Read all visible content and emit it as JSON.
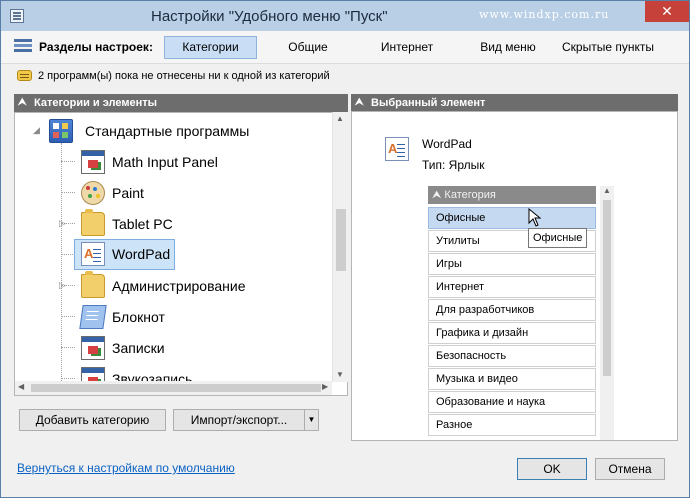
{
  "window": {
    "title": "Настройки \"Удобного меню \"Пуск\"",
    "watermark": "www.windxp.com.ru",
    "close_label": "✕"
  },
  "toolbar": {
    "label": "Разделы настроек:",
    "tabs": [
      {
        "label": "Категории",
        "active": true
      },
      {
        "label": "Общие",
        "active": false
      },
      {
        "label": "Интернет",
        "active": false
      },
      {
        "label": "Вид меню",
        "active": false
      },
      {
        "label": "Скрытые пункты",
        "active": false
      }
    ]
  },
  "info": {
    "text": "2 программ(ы) пока не отнесены ни к одной из категорий"
  },
  "left_panel": {
    "header": "Категории и элементы",
    "tree": [
      {
        "label": "Стандартные программы",
        "icon": "grid-icon",
        "expanded": true,
        "selected": false
      },
      {
        "label": "Math Input Panel",
        "icon": "window-icon",
        "expanded": false,
        "selected": false
      },
      {
        "label": "Paint",
        "icon": "palette-icon",
        "expanded": false,
        "selected": false
      },
      {
        "label": "Tablet PC",
        "icon": "folder-icon",
        "expanded": false,
        "selected": false
      },
      {
        "label": "WordPad",
        "icon": "wordpad-icon",
        "expanded": false,
        "selected": true
      },
      {
        "label": "Администрирование",
        "icon": "folder-icon",
        "expanded": false,
        "selected": false
      },
      {
        "label": "Блокнот",
        "icon": "notepad-icon",
        "expanded": false,
        "selected": false
      },
      {
        "label": "Записки",
        "icon": "window-icon",
        "expanded": false,
        "selected": false
      },
      {
        "label": "Звукозапись",
        "icon": "window-icon",
        "expanded": false,
        "selected": false
      }
    ],
    "add_category_label": "Добавить категорию",
    "import_export_label": "Импорт/экспорт..."
  },
  "right_panel": {
    "header": "Выбранный элемент",
    "item_name": "WordPad",
    "item_type": "Тип: Ярлык",
    "category_header": "Категория",
    "categories": [
      {
        "label": "Офисные",
        "active": true
      },
      {
        "label": "Утилиты",
        "active": false
      },
      {
        "label": "Игры",
        "active": false
      },
      {
        "label": "Интернет",
        "active": false
      },
      {
        "label": "Для разработчиков",
        "active": false
      },
      {
        "label": "Графика и дизайн",
        "active": false
      },
      {
        "label": "Безопасность",
        "active": false
      },
      {
        "label": "Музыка и видео",
        "active": false
      },
      {
        "label": "Образование и наука",
        "active": false
      },
      {
        "label": "Разное",
        "active": false
      }
    ],
    "tooltip": "Офисные"
  },
  "footer": {
    "reset_link": "Вернуться к настройкам по умолчанию",
    "ok_label": "OK",
    "cancel_label": "Отмена"
  },
  "colors": {
    "titlebar": "#b9cfe6",
    "close": "#c7413b",
    "active_tab": "#c9def5",
    "selection": "#cde3f8",
    "panel_header": "#6d6d6d",
    "link": "#0b62c4"
  }
}
